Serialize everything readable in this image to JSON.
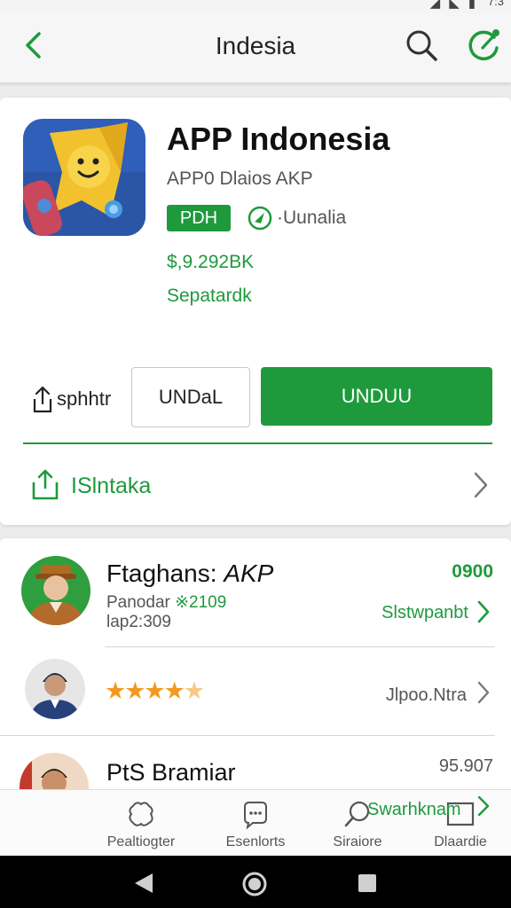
{
  "status_bar": {
    "time": "7:3"
  },
  "app_bar": {
    "title": "Indesia"
  },
  "app": {
    "name": "APP Indonesia",
    "developer": "APP0 Dlaios AKP",
    "badge": "PDH",
    "rating_label": "·Uunalia",
    "downloads": "$,9.292BK",
    "size": "Sepatardk",
    "share_label": "sphhtr",
    "secondary_button": "UNDaL",
    "install_button": "UNDUU",
    "install_row_label": "ISlntaka"
  },
  "reviews": [
    {
      "title": "Ftaghans:",
      "title_italic": "AKP",
      "meta_label": "Panodar",
      "meta_value": "※2109",
      "meta_line2": "lap2:309",
      "count": "0900",
      "action": "Slstwpanbt"
    },
    {
      "stars": "★★★★",
      "half_star": "★",
      "action": "Jlpoo.Ntra"
    },
    {
      "title": "PtS Bramiar",
      "count": "95.907"
    }
  ],
  "bottom_nav": {
    "items": [
      "Pealtiogter",
      "Esenlorts",
      "Siraiore",
      "Dlaardie"
    ],
    "overlap_label": "Swarhknam"
  },
  "colors": {
    "accent": "#1e9a3c",
    "star": "#f29a1f"
  }
}
